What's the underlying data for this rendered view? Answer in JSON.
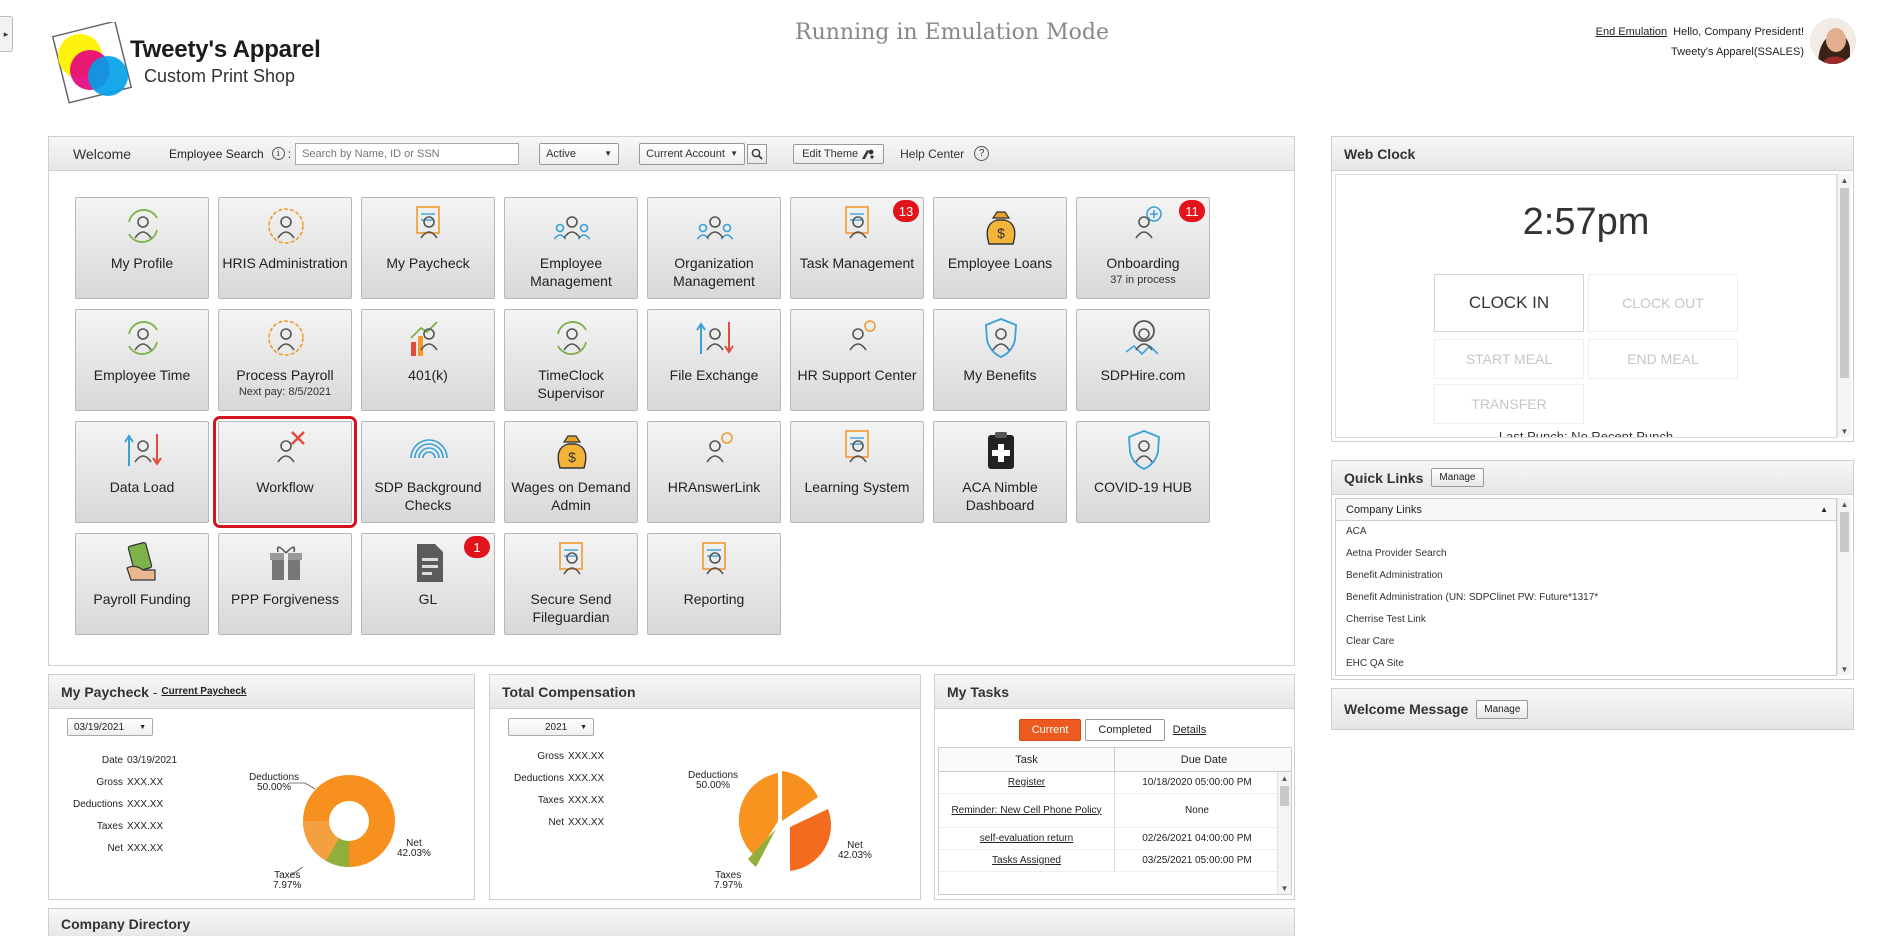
{
  "header": {
    "brand_line1": "Tweety's Apparel",
    "brand_line2": "Custom Print Shop",
    "emulation_banner": "Running in Emulation Mode",
    "end_emulation": "End Emulation",
    "greeting": "Hello, Company President!",
    "company": "Tweety's Apparel(SSALES)"
  },
  "welcome": {
    "title": "Welcome",
    "employee_search_label": "Employee Search",
    "search_placeholder": "Search by Name, ID or SSN",
    "status_select": "Active",
    "account_select": "Current Account",
    "edit_theme": "Edit Theme",
    "help_center": "Help Center"
  },
  "tiles": [
    {
      "label": "My Profile",
      "sub": "",
      "icon": "profile-refresh-icon",
      "badge": ""
    },
    {
      "label": "HRIS Administration",
      "sub": "",
      "icon": "gear-person-icon",
      "badge": ""
    },
    {
      "label": "My Paycheck",
      "sub": "",
      "icon": "paycheck-icon",
      "badge": ""
    },
    {
      "label": "Employee Management",
      "sub": "",
      "icon": "team-check-icon",
      "badge": ""
    },
    {
      "label": "Organization Management",
      "sub": "",
      "icon": "org-chart-icon",
      "badge": ""
    },
    {
      "label": "Task Management",
      "sub": "",
      "icon": "task-doc-icon",
      "badge": "13"
    },
    {
      "label": "Employee Loans",
      "sub": "",
      "icon": "money-bag-icon",
      "badge": ""
    },
    {
      "label": "Onboarding",
      "sub": "37 in process",
      "icon": "add-person-icon",
      "badge": "11"
    },
    {
      "label": "Employee Time",
      "sub": "",
      "icon": "clock-person-icon",
      "badge": ""
    },
    {
      "label": "Process Payroll",
      "sub": "Next pay: 8/5/2021",
      "icon": "dollar-gear-icon",
      "badge": ""
    },
    {
      "label": "401(k)",
      "sub": "",
      "icon": "growth-chart-icon",
      "badge": ""
    },
    {
      "label": "TimeClock Supervisor",
      "sub": "",
      "icon": "timeclock-icon",
      "badge": ""
    },
    {
      "label": "File Exchange",
      "sub": "",
      "icon": "file-exchange-icon",
      "badge": ""
    },
    {
      "label": "HR Support Center",
      "sub": "",
      "icon": "lightbulb-person-icon",
      "badge": ""
    },
    {
      "label": "My Benefits",
      "sub": "",
      "icon": "shield-person-icon",
      "badge": ""
    },
    {
      "label": "SDPHire.com",
      "sub": "",
      "icon": "hire-search-icon",
      "badge": ""
    },
    {
      "label": "Data Load",
      "sub": "",
      "icon": "data-load-icon",
      "badge": ""
    },
    {
      "label": "Workflow",
      "sub": "",
      "icon": "workflow-tools-icon",
      "badge": ""
    },
    {
      "label": "SDP Background Checks",
      "sub": "",
      "icon": "fingerprint-icon",
      "badge": ""
    },
    {
      "label": "Wages on Demand Admin",
      "sub": "",
      "icon": "wages-bag-icon",
      "badge": ""
    },
    {
      "label": "HRAnswerLink",
      "sub": "",
      "icon": "answer-person-icon",
      "badge": ""
    },
    {
      "label": "Learning System",
      "sub": "",
      "icon": "classroom-icon",
      "badge": ""
    },
    {
      "label": "ACA Nimble Dashboard",
      "sub": "",
      "icon": "clipboard-plus-icon",
      "badge": ""
    },
    {
      "label": "COVID-19 HUB",
      "sub": "",
      "icon": "covid-shield-icon",
      "badge": ""
    },
    {
      "label": "Payroll Funding",
      "sub": "",
      "icon": "cash-hand-icon",
      "badge": ""
    },
    {
      "label": "PPP Forgiveness",
      "sub": "",
      "icon": "gift-icon",
      "badge": ""
    },
    {
      "label": "GL",
      "sub": "",
      "icon": "ledger-icon",
      "badge": "1"
    },
    {
      "label": "Secure Send Fileguardian",
      "sub": "",
      "icon": "secure-send-icon",
      "badge": ""
    },
    {
      "label": "Reporting",
      "sub": "",
      "icon": "report-board-icon",
      "badge": ""
    }
  ],
  "webclock": {
    "title": "Web Clock",
    "time": "2:57pm",
    "clock_in": "CLOCK IN",
    "clock_out": "CLOCK OUT",
    "start_meal": "START MEAL",
    "end_meal": "END MEAL",
    "transfer": "TRANSFER",
    "last_punch": "Last Punch: No Recent Punch"
  },
  "quicklinks": {
    "title": "Quick Links",
    "manage": "Manage",
    "group": "Company Links",
    "items": [
      "ACA",
      "Aetna Provider Search",
      "Benefit Administration",
      "Benefit Administration (UN: SDPClinet PW: Future*1317*",
      "Cherrise Test Link",
      "Clear Care",
      "EHC QA Site"
    ]
  },
  "welcome_message": {
    "title": "Welcome Message",
    "manage": "Manage"
  },
  "paycheck": {
    "title": "My Paycheck",
    "sep": " - ",
    "link": "Current Paycheck",
    "date_select": "03/19/2021",
    "rows": [
      {
        "k": "Date",
        "v": "03/19/2021"
      },
      {
        "k": "Gross",
        "v": "XXX.XX"
      },
      {
        "k": "Deductions",
        "v": "XXX.XX"
      },
      {
        "k": "Taxes",
        "v": "XXX.XX"
      },
      {
        "k": "Net",
        "v": "XXX.XX"
      }
    ],
    "pie": {
      "deductions_label": "Deductions",
      "deductions_pct": "50.00%",
      "taxes_label": "Taxes",
      "taxes_pct": "7.97%",
      "net_label": "Net",
      "net_pct": "42.03%"
    }
  },
  "total_comp": {
    "title": "Total Compensation",
    "year_select": "2021",
    "rows": [
      {
        "k": "Gross",
        "v": "XXX.XX"
      },
      {
        "k": "Deductions",
        "v": "XXX.XX"
      },
      {
        "k": "Taxes",
        "v": "XXX.XX"
      },
      {
        "k": "Net",
        "v": "XXX.XX"
      }
    ],
    "pie": {
      "deductions_label": "Deductions",
      "deductions_pct": "50.00%",
      "taxes_label": "Taxes",
      "taxes_pct": "7.97%",
      "net_label": "Net",
      "net_pct": "42.03%"
    }
  },
  "tasks": {
    "title": "My Tasks",
    "tab_current": "Current",
    "tab_completed": "Completed",
    "tab_details": "Details",
    "col_task": "Task",
    "col_due": "Due Date",
    "rows": [
      {
        "task": "Register",
        "due": "10/18/2020 05:00:00 PM"
      },
      {
        "task": "Reminder: New Cell Phone Policy",
        "due": "None"
      },
      {
        "task": "self-evaluation return",
        "due": "02/26/2021 04:00:00 PM"
      },
      {
        "task": "Tasks Assigned",
        "due": "03/25/2021 05:00:00 PM"
      }
    ]
  },
  "directory": {
    "title": "Company Directory"
  },
  "colors": {
    "accent_orange": "#ec5a1f",
    "badge_red": "#e3131c",
    "selected_outline": "#d7121f",
    "pie_orange": "#f7901e",
    "pie_green": "#8fae3c"
  }
}
